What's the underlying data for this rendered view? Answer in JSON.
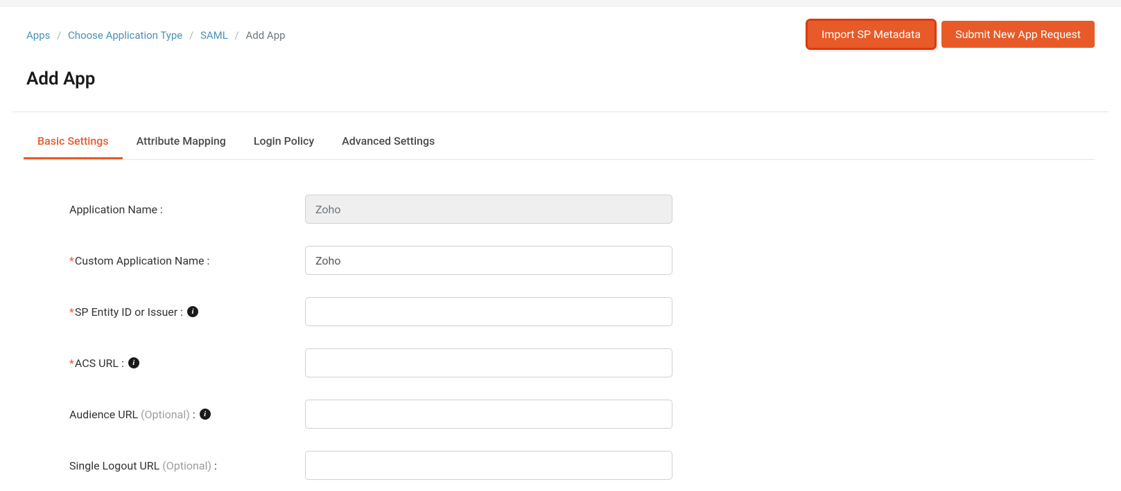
{
  "breadcrumb": {
    "items": [
      {
        "label": "Apps",
        "link": true
      },
      {
        "label": "Choose Application Type",
        "link": true
      },
      {
        "label": "SAML",
        "link": true
      },
      {
        "label": "Add App",
        "link": false
      }
    ]
  },
  "actions": {
    "import_label": "Import SP Metadata",
    "submit_label": "Submit New App Request"
  },
  "page_title": "Add App",
  "tabs": [
    {
      "label": "Basic Settings",
      "active": true
    },
    {
      "label": "Attribute Mapping",
      "active": false
    },
    {
      "label": "Login Policy",
      "active": false
    },
    {
      "label": "Advanced Settings",
      "active": false
    }
  ],
  "form": {
    "app_name": {
      "label": "Application Name :",
      "value": "Zoho",
      "required": false,
      "optional": false,
      "info": false,
      "disabled": true
    },
    "custom_app_name": {
      "label": "Custom Application Name :",
      "value": "Zoho",
      "required": true,
      "optional": false,
      "info": false,
      "disabled": false
    },
    "sp_entity": {
      "label": "SP Entity ID or Issuer :",
      "value": "",
      "required": true,
      "optional": false,
      "info": true,
      "disabled": false
    },
    "acs_url": {
      "label": "ACS URL :",
      "value": "",
      "required": true,
      "optional": false,
      "info": true,
      "disabled": false
    },
    "audience_url": {
      "label_prefix": "Audience URL ",
      "label_optional": "(Optional)",
      "label_suffix": " :",
      "value": "",
      "required": false,
      "optional": true,
      "info": true,
      "disabled": false
    },
    "slo_url": {
      "label_prefix": "Single Logout URL ",
      "label_optional": "(Optional)",
      "label_suffix": " :",
      "value": "",
      "required": false,
      "optional": true,
      "info": false,
      "disabled": false
    }
  },
  "info_glyph": "i"
}
